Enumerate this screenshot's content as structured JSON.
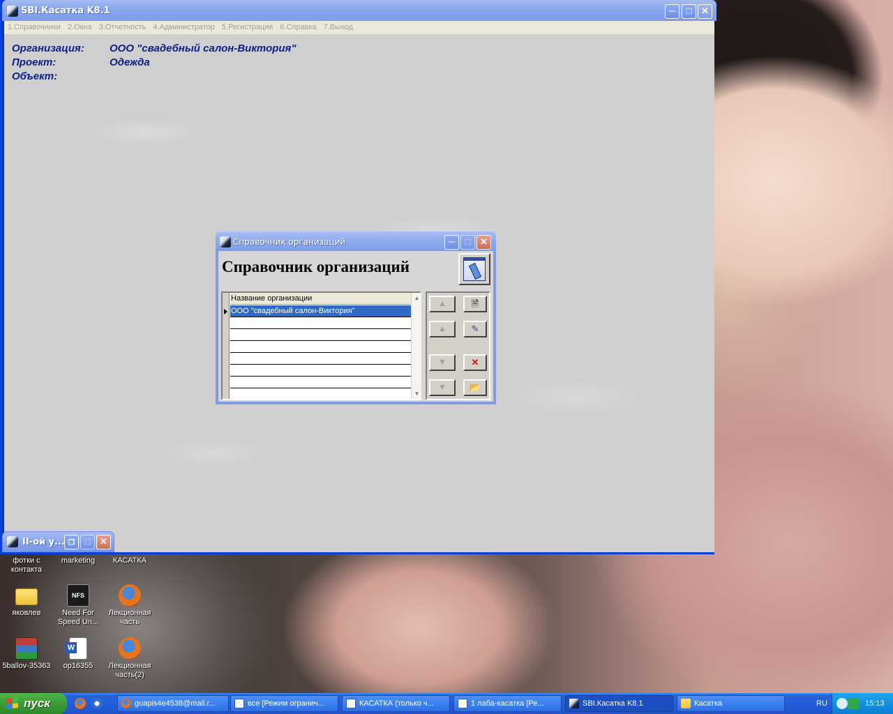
{
  "main_window": {
    "title": "SBI.Касатка K8.1",
    "menu": [
      "1.Справочники",
      "2.Окна",
      "3.Отчетность",
      "4.Администратор",
      "5.Регистрация",
      "6.Справка",
      "7.Выход"
    ],
    "info": {
      "org_label": "Организация:",
      "org_value": "ООО \"свадебный салон-Виктория\"",
      "project_label": "Проект:",
      "project_value": "Одежда",
      "object_label": "Объект:"
    }
  },
  "dialog": {
    "title": "Справочник организаций",
    "heading": "Справочник организаций",
    "grid": {
      "column_header": "Название организации",
      "rows": [
        "ООО \"свадебный салон-Виктория\"",
        "",
        "",
        "",
        "",
        "",
        ""
      ],
      "selected_index": 0
    },
    "nav_buttons": [
      "first-record",
      "previous-record",
      "next-record",
      "last-record"
    ],
    "action_buttons": [
      "new-record",
      "edit-record",
      "delete-record",
      "open-record"
    ]
  },
  "minimized_window": {
    "title": "II-ой у..."
  },
  "desktop_icons": [
    {
      "label": "фотки с контакта",
      "icon": "folder"
    },
    {
      "label": "marketing",
      "icon": "folder"
    },
    {
      "label": "КАСАТКА",
      "icon": "folder"
    },
    {
      "label": "яковлев",
      "icon": "folder"
    },
    {
      "label": "Need For Speed Un...",
      "icon": "game"
    },
    {
      "label": "Лекционная часть",
      "icon": "firefox"
    },
    {
      "label": "5ballov-35363",
      "icon": "winrar"
    },
    {
      "label": "op16355",
      "icon": "word-doc"
    },
    {
      "label": "Лекционная часть(2)",
      "icon": "firefox"
    }
  ],
  "taskbar": {
    "start_label": "пуск",
    "tasks": [
      {
        "label": "guapis4e4538@mail.r...",
        "icon": "firefox"
      },
      {
        "label": "все [Режим огранич...",
        "icon": "word"
      },
      {
        "label": "КАСАТКА (только ч...",
        "icon": "word"
      },
      {
        "label": "1 лаба-касатка [Ре...",
        "icon": "word"
      },
      {
        "label": "SBI.Касатка K8.1",
        "icon": "app",
        "active": true
      },
      {
        "label": "Касатка",
        "icon": "folder"
      }
    ],
    "language": "RU",
    "clock": "15:13"
  }
}
